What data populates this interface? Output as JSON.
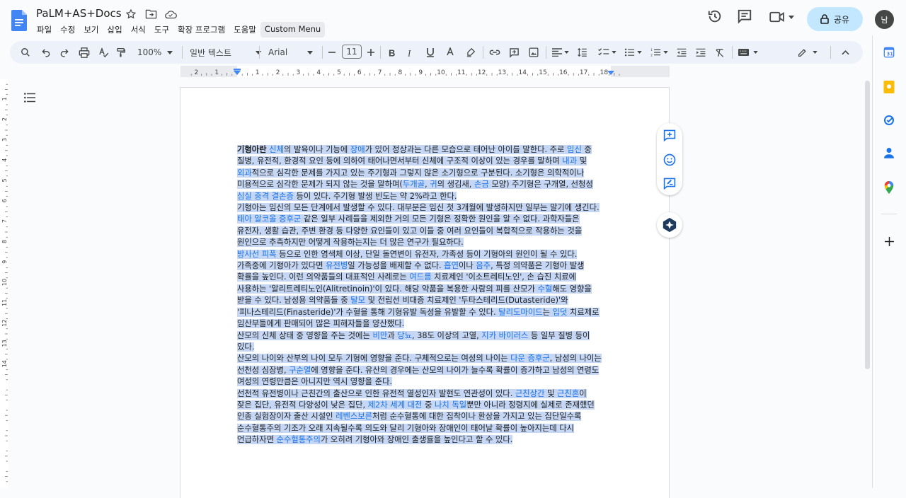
{
  "header": {
    "doc_title": "PaLM+AS+Docs",
    "menu": [
      "파일",
      "수정",
      "보기",
      "삽입",
      "서식",
      "도구",
      "확장 프로그램",
      "도움말",
      "Custom Menu"
    ],
    "share_label": "공유",
    "avatar_initial": "남"
  },
  "toolbar": {
    "zoom": "100%",
    "style": "일반 텍스트",
    "font": "Arial",
    "font_size": "11"
  },
  "ruler": {
    "labels": [
      "2",
      "1",
      "1",
      "2",
      "3",
      "4",
      "5",
      "6",
      "7",
      "8",
      "9",
      "10",
      "11",
      "12",
      "13",
      "14",
      "15",
      "16",
      "17",
      "18"
    ],
    "vlabels": [
      "1",
      "2",
      "3",
      "4",
      "5",
      "6",
      "7",
      "8",
      "9",
      "10",
      "11",
      "12",
      "13",
      "14"
    ]
  },
  "document": {
    "lines": [
      [
        {
          "t": "기형아란",
          "b": true
        },
        {
          "t": " "
        },
        {
          "t": "신체",
          "l": true
        },
        {
          "t": "의 발육이나 기능에 "
        },
        {
          "t": "장애",
          "l": true
        },
        {
          "t": "가 있어 정상과는 다른 모습으로 태어난 아이를 말한다. 주로 "
        },
        {
          "t": "임신",
          "l": true
        },
        {
          "t": " 중"
        }
      ],
      [
        {
          "t": "질병, 유전적, 환경적 요인 등에 의하여 태어나면서부터 신체에 구조적 이상이 있는 경우를 말하며 "
        },
        {
          "t": "내과",
          "l": true
        },
        {
          "t": " 및"
        }
      ],
      [
        {
          "t": "외과",
          "l": true
        },
        {
          "t": "적으로 심각한 문제를 가지고 있는 주기형과 그렇지 않은 소기형으로 구분된다. 소기형은 의학적이나"
        }
      ],
      [
        {
          "t": "미용적으로 심각한 문제가 되지 않는 것을 말하며("
        },
        {
          "t": "두개골",
          "l": true
        },
        {
          "t": ", "
        },
        {
          "t": "귀",
          "l": true
        },
        {
          "t": "의 생김새, "
        },
        {
          "t": "손금",
          "l": true
        },
        {
          "t": " 모양) 주기형은 구개열, 선청성"
        }
      ],
      [
        {
          "t": "심실 중격 결손증",
          "l": true
        },
        {
          "t": " 등이 있다. 주기형 발생 빈도는 약 2%라고 한다."
        }
      ],
      [
        {
          "t": "기형아는 임신의 모든 단계에서 발생할 수 있다. 대부분은 임신 첫 3개월에 발생하지만 일부는 말기에 생긴다."
        }
      ],
      [
        {
          "t": "태아 알코올 증후군",
          "l": true
        },
        {
          "t": " 같은 일부 사례들을 제외한 거의 모든 기형은 정확한 원인을 알 수 없다. 과학자들은"
        }
      ],
      [
        {
          "t": "유전자, 생활 습관, 주변 환경 등 다양한 요인들이 있고 이들 중 여러 요인들이 복합적으로 작용하는 것을"
        }
      ],
      [
        {
          "t": "원인으로 추측하지만 어떻게 작용하는지는 더 많은 연구가 필요하다."
        }
      ],
      [
        {
          "t": "방사선 피폭",
          "l": true
        },
        {
          "t": " 등으로 인한 염색체 이상, 단일 돌연변이 유전자, 가족성 등이 기형아의 원인이 될 수 있다."
        }
      ],
      [
        {
          "t": "가족중에 기형아가 있다면 "
        },
        {
          "t": "유전병",
          "l": true
        },
        {
          "t": "일 가능성을 배제할 수 없다. "
        },
        {
          "t": "흡연",
          "l": true
        },
        {
          "t": "이나 "
        },
        {
          "t": "음주",
          "l": true
        },
        {
          "t": ", 특정 의약품은 기형아 발생"
        }
      ],
      [
        {
          "t": "확률을 높인다. 이런 의약품들의 대표적인 사례로는 "
        },
        {
          "t": "여드름",
          "l": true
        },
        {
          "t": " 치료제인 '이소트레티노인', 손 습진 치료에"
        }
      ],
      [
        {
          "t": "사용하는 '알리트레티노인(Alitretinoin)'이 있다. 해당 약품을 복용한 사람의 피를 산모가 "
        },
        {
          "t": "수혈",
          "l": true
        },
        {
          "t": "해도 영향을"
        }
      ],
      [
        {
          "t": "받을 수 있다. 남성용 의약품들 중 "
        },
        {
          "t": "탈모",
          "l": true
        },
        {
          "t": " 및 전립선 비대증 치료제인 '두타스테리드(Dutasteride)'와"
        }
      ],
      [
        {
          "t": "'피나스테리드(Finasteride)'가 수혈을 통해 기형유발 독성을 유발할 수 있다. "
        },
        {
          "t": "탈리도마이드",
          "l": true
        },
        {
          "t": "는 "
        },
        {
          "t": "입덧",
          "l": true
        },
        {
          "t": " 치료제로"
        }
      ],
      [
        {
          "t": "임산부들에게 판매되어 많은 피해자들을 양산했다."
        }
      ],
      [
        {
          "t": "산모의 신체 상태 중 영향을 주는 것에는 "
        },
        {
          "t": "비만",
          "l": true
        },
        {
          "t": "과 "
        },
        {
          "t": "당뇨",
          "l": true
        },
        {
          "t": ", 38도 이상의 고열, "
        },
        {
          "t": "지카 바이러스",
          "l": true
        },
        {
          "t": " 등 일부 질병 등이"
        }
      ],
      [
        {
          "t": "있다."
        }
      ],
      [
        {
          "t": "산모의 나이와 산부의 나이 모두 기형에 영향을 준다. 구체적으로는 여성의 나이는 "
        },
        {
          "t": "다운 증후군",
          "l": true
        },
        {
          "t": ", 남성의 나이는"
        }
      ],
      [
        {
          "t": "선천성 심장병, "
        },
        {
          "t": "구순열",
          "l": true
        },
        {
          "t": "에 영향을 준다. 유산의 경우에는 산모의 나이가 늘수록 확률이 증가하고 남성의 연령도"
        }
      ],
      [
        {
          "t": "여성의 연령만큼은 아니지만 역시 영향을 준다."
        }
      ],
      [
        {
          "t": "선천적 유전병이나 근친간의 출산으로 인한 유전적 열성인자 발현도 연관성이 있다. "
        },
        {
          "t": "근친상간",
          "l": true
        },
        {
          "t": " 및 "
        },
        {
          "t": "근친혼",
          "l": true
        },
        {
          "t": "이"
        }
      ],
      [
        {
          "t": "잦은 집단, 유전적 다양성이 낮은 집단, "
        },
        {
          "t": "제2차 세계 대전",
          "l": true
        },
        {
          "t": " 중 "
        },
        {
          "t": "나치 독일",
          "l": true
        },
        {
          "t": "뿐만 아니라 정령지에 실제로 존재했던"
        }
      ],
      [
        {
          "t": "인종 실험장이자 출산 시설인 "
        },
        {
          "t": "레벤스보른",
          "l": true
        },
        {
          "t": "처럼 순수혈통에 대한 집착이나 환상을 가지고 있는 집단일수록"
        }
      ],
      [
        {
          "t": "순수혈통주의 기조가 오래 지속될수록 의도와 달리 기형아와 장애인이 태어날 확률이 높아지는데 다시"
        }
      ],
      [
        {
          "t": "언급하자면 "
        },
        {
          "t": "순수혈통주의",
          "l": true
        },
        {
          "t": "가 오히려 기형아와 장애인 출생률을 높인다고 할 수 있다."
        }
      ]
    ]
  }
}
